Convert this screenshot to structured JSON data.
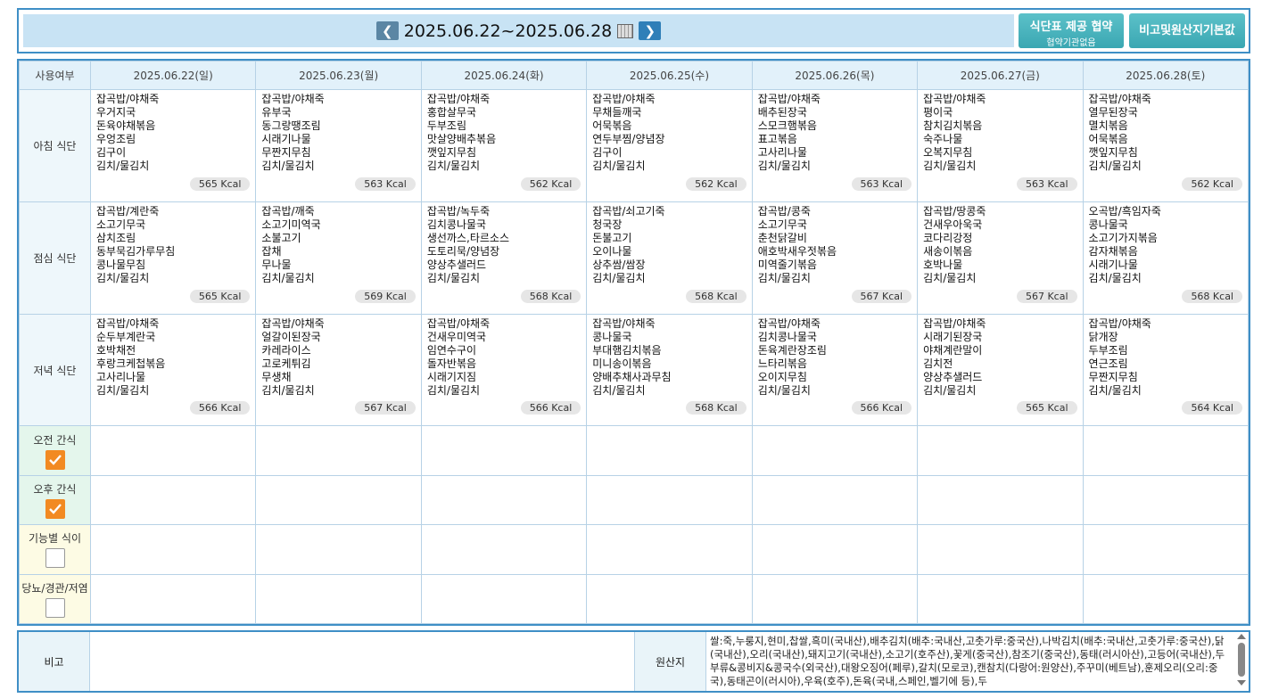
{
  "header": {
    "week_range": "2025.06.22~2025.06.28",
    "agree_line1": "식단표 제공 협약",
    "agree_line2": "협약기관없음",
    "origin_button": "비고및원산지기본값"
  },
  "table": {
    "corner": "사용여부",
    "days": [
      "2025.06.22(일)",
      "2025.06.23(월)",
      "2025.06.24(화)",
      "2025.06.25(수)",
      "2025.06.26(목)",
      "2025.06.27(금)",
      "2025.06.28(토)"
    ],
    "meals": [
      {
        "label": "아침 식단",
        "cells": [
          {
            "dishes": "잡곡밥/야채죽\n우거지국\n돈육야채볶음\n우엉조림\n김구이\n김치/물김치",
            "kcal": "565 Kcal"
          },
          {
            "dishes": "잡곡밥/야채죽\n유부국\n동그랑땡조림\n시래기나물\n무짠지무침\n김치/물김치",
            "kcal": "563 Kcal"
          },
          {
            "dishes": "잡곡밥/야채죽\n홍합살무국\n두부조림\n맛살양배추볶음\n깻잎지무침\n김치/물김치",
            "kcal": "562 Kcal"
          },
          {
            "dishes": "잡곡밥/야채죽\n무채들깨국\n어묵볶음\n연두부찜/양념장\n김구이\n김치/물김치",
            "kcal": "562 Kcal"
          },
          {
            "dishes": "잡곡밥/야채죽\n배추된장국\n스모크햄볶음\n표고볶음\n고사리나물\n김치/물김치",
            "kcal": "563 Kcal"
          },
          {
            "dishes": "잡곡밥/야채죽\n평이국\n참치김치볶음\n숙주나물\n오복지무침\n김치/물김치",
            "kcal": "563 Kcal"
          },
          {
            "dishes": "잡곡밥/야채죽\n열무된장국\n멸치볶음\n어묵볶음\n깻잎지무침\n김치/물김치",
            "kcal": "562 Kcal"
          }
        ]
      },
      {
        "label": "점심 식단",
        "cells": [
          {
            "dishes": "잡곡밥/계란죽\n소고기무국\n삼치조림\n동부묵김가루무침\n콩나물무침\n김치/물김치",
            "kcal": "565 Kcal"
          },
          {
            "dishes": "잡곡밥/깨죽\n소고기미역국\n소불고기\n잡채\n무나물\n김치/물김치",
            "kcal": "569 Kcal"
          },
          {
            "dishes": "잡곡밥/녹두죽\n김치콩나물국\n생선까스,타르소스\n도토리묵/양념장\n양상추샐러드\n김치/물김치",
            "kcal": "568 Kcal"
          },
          {
            "dishes": "잡곡밥/쇠고기죽\n청국장\n돈불고기\n오이나물\n상추쌈/쌈장\n김치/물김치",
            "kcal": "568 Kcal"
          },
          {
            "dishes": "잡곡밥/콩죽\n소고기무국\n춘천닭갈비\n애호박새우젓볶음\n미역줄기볶음\n김치/물김치",
            "kcal": "567 Kcal"
          },
          {
            "dishes": "잡곡밥/땅콩죽\n건새우아욱국\n코다리강정\n새송이볶음\n호박나물\n김치/물김치",
            "kcal": "567 Kcal"
          },
          {
            "dishes": "오곡밥/흑임자죽\n콩나물국\n소고기가지볶음\n감자채볶음\n시래기나물\n김치/물김치",
            "kcal": "568 Kcal"
          }
        ]
      },
      {
        "label": "저녁 식단",
        "cells": [
          {
            "dishes": "잡곡밥/야채죽\n순두부계란국\n호박채전\n후랑크케첩볶음\n고사리나물\n김치/물김치",
            "kcal": "566 Kcal"
          },
          {
            "dishes": "잡곡밥/야채죽\n얼갈이된장국\n카레라이스\n고로케튀김\n무생채\n김치/물김치",
            "kcal": "567 Kcal"
          },
          {
            "dishes": "잡곡밥/야채죽\n건새우미역국\n임연수구이\n돌자반볶음\n시래기지짐\n김치/물김치",
            "kcal": "566 Kcal"
          },
          {
            "dishes": "잡곡밥/야채죽\n콩나물국\n부대햄김치볶음\n미니송이볶음\n양배추채사과무침\n김치/물김치",
            "kcal": "568 Kcal"
          },
          {
            "dishes": "잡곡밥/야채죽\n김치콩나물국\n돈육계란장조림\n느타리볶음\n오이지무침\n김치/물김치",
            "kcal": "566 Kcal"
          },
          {
            "dishes": "잡곡밥/야채죽\n시래기된장국\n야채계란말이\n김치전\n양상추샐러드\n김치/물김치",
            "kcal": "565 Kcal"
          },
          {
            "dishes": "잡곡밥/야채죽\n닭개장\n두부조림\n연근조림\n무짠지무침\n김치/물김치",
            "kcal": "564 Kcal"
          }
        ]
      }
    ],
    "snacks": [
      {
        "label": "오전 간식",
        "checked": true,
        "tint": "green"
      },
      {
        "label": "오후 간식",
        "checked": true,
        "tint": "green"
      },
      {
        "label": "기능별 식이",
        "checked": false,
        "tint": "cream"
      },
      {
        "label": "당뇨/경관/저염",
        "checked": false,
        "tint": "cream"
      }
    ]
  },
  "footer": {
    "note_label": "비고",
    "origin_label": "원산지",
    "origin_text": "쌀:죽,누룽지,현미,찹쌀,흑미(국내산),배추김치(배추:국내산,고춧가루:중국산),나박김치(배추:국내산,고춧가루:중국산),닭(국내산),오리(국내산),돼지고기(국내산),소고기(호주산),꽃게(중국산),참조기(중국산),동태(러시아산),고등어(국내산),두부류&콩비지&콩국수(외국산),대왕오징어(페루),갈치(모로코),캔참치(다랑어:원양산),주꾸미(베트남),훈제오리(오리:중국),동태곤이(러시아),우육(호주),돈육(국내,스페인,벨기에 등),두"
  }
}
